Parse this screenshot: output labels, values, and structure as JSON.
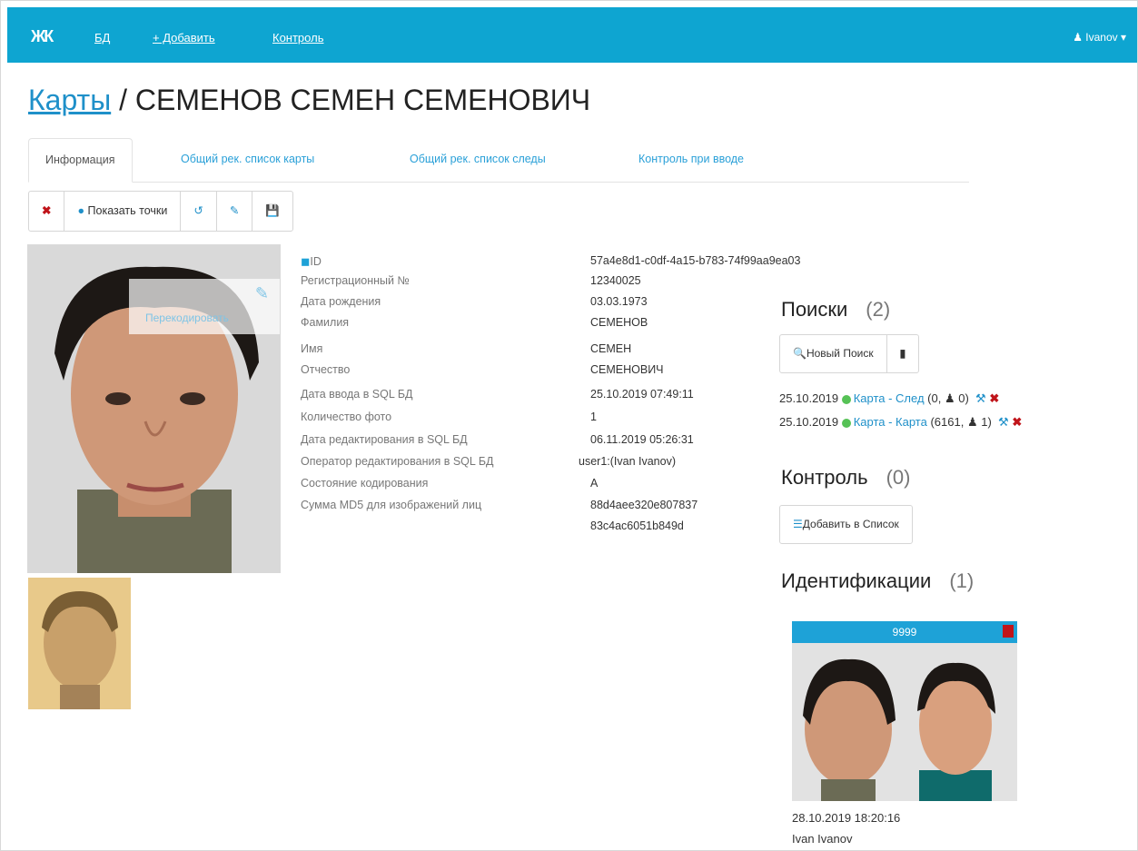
{
  "nav": {
    "logo": "ЖК",
    "links": [
      "БД",
      "+ Добавить",
      "Контроль"
    ],
    "user": "Ivanov"
  },
  "title": {
    "link": "Карты",
    "name": "/ СЕМЕНОВ СЕМЕН СЕМЕНОВИЧ"
  },
  "tabs": [
    "Информация",
    "Общий рек. список карты",
    "Общий рек. список следы",
    "Контроль при вводе"
  ],
  "toolbar": {
    "show_points": "Показать точки"
  },
  "photo": {
    "overlay_label": "Перекодировать"
  },
  "info": [
    {
      "label": "ID",
      "value": "57a4e8d1-c0df-4a15-b783-74f99aa9ea03"
    },
    {
      "label": "Регистрационный №",
      "value": "12340025"
    },
    {
      "label": "Дата рождения",
      "value": "03.03.1973"
    },
    {
      "label": "Фамилия",
      "value": "СЕМЕНОВ"
    },
    {
      "label": "Имя",
      "value": "СЕМЕН"
    },
    {
      "label": "Отчество",
      "value": "СЕМЕНОВИЧ"
    },
    {
      "label": "Дата ввода в SQL БД",
      "value": "25.10.2019 07:49:11"
    },
    {
      "label": "Количество фото",
      "value": "1"
    },
    {
      "label": "Дата редактирования в SQL БД",
      "value": "06.11.2019 05:26:31"
    },
    {
      "label": "Оператор редактирования в SQL БД",
      "value": "user1:(Ivan Ivanov)"
    },
    {
      "label": "Состояние кодирования",
      "value": "A"
    },
    {
      "label": "Сумма MD5 для изображений лиц",
      "value": "88d4aee320e807837"
    },
    {
      "label": "",
      "value": "83c4ac6051b849d"
    }
  ],
  "searches": {
    "title": "Поиски",
    "count": "(2)",
    "new_search": "Новый Поиск",
    "rows": [
      {
        "date": "25.10.2019",
        "link": "Карта - След",
        "detail": "(0,",
        "extra": "0)"
      },
      {
        "date": "25.10.2019",
        "link": "Карта - Карта",
        "detail": "(6161,",
        "extra": "1)"
      }
    ]
  },
  "control": {
    "title": "Контроль",
    "count": "(0)",
    "add_list": "Добавить в Список"
  },
  "identifications": {
    "title": "Идентификации",
    "count": "(1)",
    "card_score": "9999",
    "date": "28.10.2019 18:20:16",
    "user": "Ivan Ivanov"
  }
}
